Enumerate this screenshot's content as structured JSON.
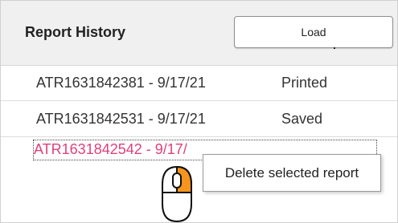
{
  "header": {
    "title": "Report History",
    "load_label": "Load"
  },
  "reports": [
    {
      "name": "ATR1631842381 - 9/17/21",
      "status": "Printed"
    },
    {
      "name": "ATR1631842531 - 9/17/21",
      "status": "Saved"
    },
    {
      "name": "ATR1631842542 - 9/17/",
      "status": ""
    }
  ],
  "context_menu": {
    "item_label": "Delete selected report"
  },
  "colors": {
    "selected_text": "#e0407a",
    "mouse_button_highlight": "#f7941d"
  },
  "icons": {
    "mouse": "mouse-right-click-icon"
  }
}
